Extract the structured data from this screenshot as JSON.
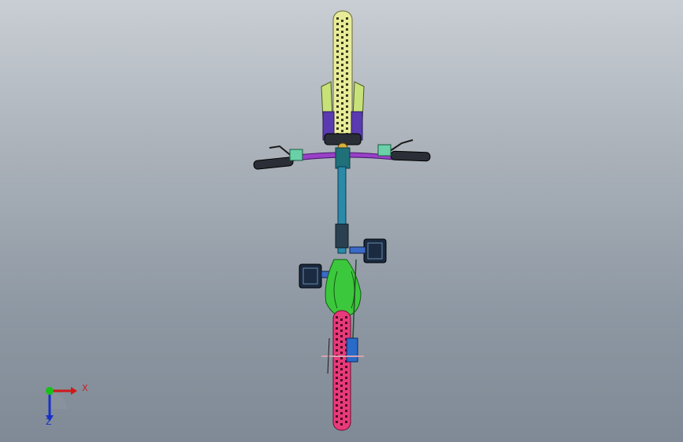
{
  "viewport": {
    "background_top": "#c9ced4",
    "background_bottom": "#7f8a96"
  },
  "model": {
    "parts": {
      "front_tire": "#e8ec9a",
      "fork_leg": "#c8e27a",
      "shock": "#5a3ab0",
      "handlebar": "#9a40c8",
      "grip": "#2a2e36",
      "brake_lever": "#6ad0a8",
      "stem": "#20707a",
      "frame_tube": "#2a8aa8",
      "pedal": "#1a2a40",
      "chainring": "#3cc83c",
      "rear_tire": "#e83a7a",
      "rear_hub": "#2a6ac8"
    }
  },
  "triad": {
    "x_label": "X",
    "z_label": "Z",
    "x_color": "#d01818",
    "y_color": "#18c018",
    "z_color": "#1830c8"
  }
}
